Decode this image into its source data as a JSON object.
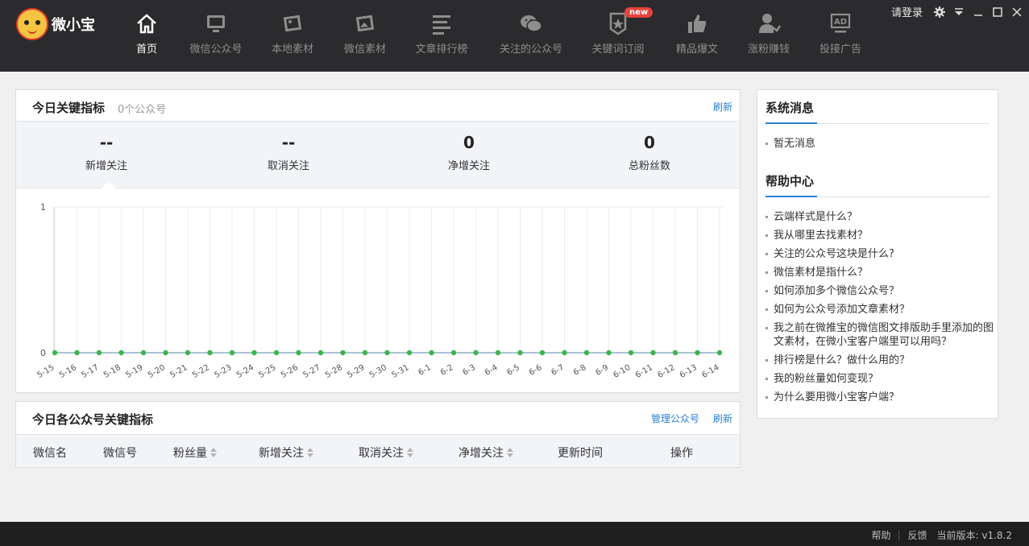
{
  "app": {
    "name": "微小宝",
    "login": "请登录"
  },
  "nav": [
    {
      "label": "首页",
      "icon": "home-icon",
      "active": true
    },
    {
      "label": "微信公众号",
      "icon": "monitor-icon"
    },
    {
      "label": "本地素材",
      "icon": "image-icon"
    },
    {
      "label": "微信素材",
      "icon": "picture-icon"
    },
    {
      "label": "文章排行榜",
      "icon": "list-icon"
    },
    {
      "label": "关注的公众号",
      "icon": "wechat-icon"
    },
    {
      "label": "关键词订阅",
      "icon": "badge-star-icon",
      "badge": "new"
    },
    {
      "label": "精品爆文",
      "icon": "thumbs-up-icon"
    },
    {
      "label": "涨粉赚钱",
      "icon": "user-money-icon"
    },
    {
      "label": "投接广告",
      "icon": "ad-icon"
    }
  ],
  "metrics_panel": {
    "title": "今日关键指标",
    "subtitle": "0个公众号",
    "refresh": "刷新",
    "stats": [
      {
        "value": "--",
        "label": "新增关注"
      },
      {
        "value": "--",
        "label": "取消关注"
      },
      {
        "value": "0",
        "label": "净增关注"
      },
      {
        "value": "0",
        "label": "总粉丝数"
      }
    ]
  },
  "chart_data": {
    "type": "line",
    "categories": [
      "5-15",
      "5-16",
      "5-17",
      "5-18",
      "5-19",
      "5-20",
      "5-21",
      "5-22",
      "5-23",
      "5-24",
      "5-25",
      "5-26",
      "5-27",
      "5-28",
      "5-29",
      "5-30",
      "5-31",
      "6-1",
      "6-2",
      "6-3",
      "6-4",
      "6-5",
      "6-6",
      "6-7",
      "6-8",
      "6-9",
      "6-10",
      "6-11",
      "6-12",
      "6-13",
      "6-14"
    ],
    "series": [
      {
        "values": [
          0,
          0,
          0,
          0,
          0,
          0,
          0,
          0,
          0,
          0,
          0,
          0,
          0,
          0,
          0,
          0,
          0,
          0,
          0,
          0,
          0,
          0,
          0,
          0,
          0,
          0,
          0,
          0,
          0,
          0,
          0
        ]
      }
    ],
    "ylim": [
      0,
      1
    ],
    "yticks": [
      "0",
      "1"
    ],
    "grid": true,
    "point_color": "#3bb54a",
    "line_color": "#a8c3d6"
  },
  "accounts_panel": {
    "title": "今日各公众号关键指标",
    "manage": "管理公众号",
    "refresh": "刷新",
    "columns": [
      {
        "label": "微信名",
        "sortable": false
      },
      {
        "label": "微信号",
        "sortable": false
      },
      {
        "label": "粉丝量",
        "sortable": true
      },
      {
        "label": "新增关注",
        "sortable": true
      },
      {
        "label": "取消关注",
        "sortable": true
      },
      {
        "label": "净增关注",
        "sortable": true
      },
      {
        "label": "更新时间",
        "sortable": false
      },
      {
        "label": "操作",
        "sortable": false
      }
    ]
  },
  "sidebar": {
    "messages_title": "系统消息",
    "messages": [
      "暂无消息"
    ],
    "help_title": "帮助中心",
    "help_items": [
      "云端样式是什么？",
      "我从哪里去找素材？",
      "关注的公众号这块是什么?",
      "微信素材是指什么？",
      "如何添加多个微信公众号？",
      "如何为公众号添加文章素材？",
      "我之前在微推宝的微信图文排版助手里添加的图文素材，在微小宝客户端里可以用吗？",
      "排行榜是什么？做什么用的？",
      "我的粉丝量如何变现？",
      "为什么要用微小宝客户端？"
    ]
  },
  "footer": {
    "help": "帮助",
    "feedback": "反馈",
    "version": "当前版本: v1.8.2"
  },
  "colors": {
    "header_bg": "#2b2b2d",
    "accent": "#2a7fd4",
    "badge": "#e5423a"
  }
}
